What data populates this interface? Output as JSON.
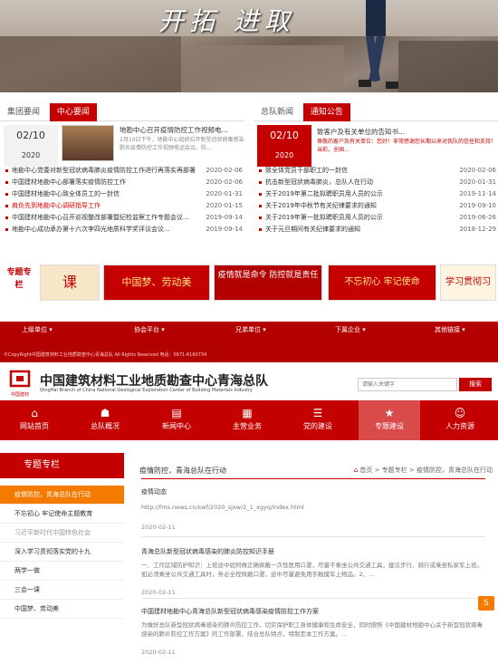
{
  "banner": {
    "slogan": "开拓 进取"
  },
  "left_news": {
    "tabs": [
      "集团要闻",
      "中心要闻"
    ],
    "feature": {
      "date": "02/10",
      "year": "2020",
      "title": "地勘中心召开疫情防控工作视频电...",
      "summary": "2月10日下午，地勘中心组织召开新型冠状病毒感染肺炎疫情防控工作视频电话会议。防..."
    },
    "items": [
      {
        "title": "地勘中心党委对新型冠状病毒肺炎疫情防控工作进行再落实再部署",
        "date": "2020-02-06",
        "highlight": false
      },
      {
        "title": "中国建材地勘中心部署落实疫情防控工作",
        "date": "2020-02-06",
        "highlight": false
      },
      {
        "title": "中国建材地勘中心致全体员工的一封信",
        "date": "2020-01-31",
        "highlight": false
      },
      {
        "title": "肩负先到地勘中心调研指导工作",
        "date": "2020-01-15",
        "highlight": true
      },
      {
        "title": "中国建材地勘中心召开巡视整改部署暨纪检监察工作专题会议...",
        "date": "2019-09-14",
        "highlight": false
      },
      {
        "title": "地勘中心成功承办第十六次李四光地质科学奖评议会议...",
        "date": "2019-09-14",
        "highlight": false
      }
    ]
  },
  "right_news": {
    "tabs": [
      "总队新闻",
      "通知公告"
    ],
    "feature": {
      "date": "02/10",
      "year": "2020",
      "title": "致客户及有关单位的告知书...",
      "summary": "尊敬的客户及有关单位：您好！非常感谢您长期以来对我队的信任和支持！当前，全国..."
    },
    "items": [
      {
        "title": "致全体党员干部职工的一封信",
        "date": "2020-02-06"
      },
      {
        "title": "抗击新型冠状病毒肺炎，总队人在行动",
        "date": "2020-01-31"
      },
      {
        "title": "关于2019年第二批拟聘职员用人员的公示",
        "date": "2019-11-14"
      },
      {
        "title": "关于2019年中秋节有关纪律要求的通知",
        "date": "2019-09-10"
      },
      {
        "title": "关于2019年第一批拟聘职员用人员的公示",
        "date": "2019-06-26"
      },
      {
        "title": "关于元旦期间有关纪律要求的通知",
        "date": "2018-12-29"
      }
    ]
  },
  "special": {
    "label": "专题专栏",
    "cards": [
      {
        "text": "课",
        "bg": "#f6e7c8",
        "color": "#c40000"
      },
      {
        "text": "中国梦、劳动美",
        "bg": "#c40000",
        "color": "#ffe680"
      },
      {
        "text": "疫情就是命令 防控就是责任",
        "bg": "#b30000",
        "color": "#fff"
      },
      {
        "text": "不忘初心 牢记使命",
        "bg": "#c40000",
        "color": "#ffe680"
      },
      {
        "text": "学习贯彻习",
        "bg": "#fff4e0",
        "color": "#c40000"
      }
    ]
  },
  "footer": {
    "selects": [
      "上级单位",
      "协会平台",
      "兄弟单位",
      "下属企业",
      "其他链接"
    ],
    "copyright": "©CopyRight中国建筑材料工业地质勘查中心青海总队 All Rights Reserved 电话：0971-6160734"
  },
  "header2": {
    "logo_text": "中国建材",
    "org_cn": "中国建筑材料工业地质勘查中心青海总队",
    "org_en": "QingHai Branch of China National Geological Exploration Center of Building Materials Industry",
    "search_placeholder": "请输入关键字",
    "search_button": "搜索"
  },
  "nav2": [
    {
      "label": "网站首页",
      "icon": "⌂"
    },
    {
      "label": "总队概况",
      "icon": "☗"
    },
    {
      "label": "新闻中心",
      "icon": "▤"
    },
    {
      "label": "主营业务",
      "icon": "▦"
    },
    {
      "label": "党的建设",
      "icon": "☰"
    },
    {
      "label": "专题建设",
      "icon": "★"
    },
    {
      "label": "人力资源",
      "icon": "☺"
    }
  ],
  "sidebar": {
    "title": "专题专栏",
    "items": [
      {
        "label": "疫情防控，青海总队在行动",
        "state": "active"
      },
      {
        "label": "不忘初心 牢记使命主题教育",
        "state": ""
      },
      {
        "label": "习近平新时代中国特色社会",
        "state": "dim"
      },
      {
        "label": "深入学习贯彻落实党的十九",
        "state": ""
      },
      {
        "label": "两学一做",
        "state": ""
      },
      {
        "label": "三会一课",
        "state": ""
      },
      {
        "label": "中国梦、劳动美",
        "state": ""
      }
    ]
  },
  "main": {
    "title": "疫情防控，青海总队在行动",
    "breadcrumb": "首页 > 专题专栏 > 疫情防控，青海总队在行动",
    "articles": [
      {
        "title": "疫情动态",
        "summary": "http://fms.news.cn/swf/2020_sjxw/2_1_xgyq/index.html",
        "date": "2020-02-11"
      },
      {
        "title": "青海总队新型冠状病毒感染的肺炎防控知识手册",
        "summary": "一、工作区域防护知识：上班途中如何做正确佩戴一次性医用口罩，尽量不乘坐公共交通工具，建议步行、骑行或乘坐私家车上班。如必须乘坐公共交通工具时，务必全程佩戴口罩，途中尽量避免用手触摸车上物品。2、...",
        "date": "2020-02-11"
      },
      {
        "title": "中国建材地勘中心青海总队新型冠状病毒感染疫情防控工作方案",
        "summary": "为做好总队新型冠状病毒感染的肺炎防控工作，切实保护职工身体健康和生命安全，同时按照《中国建材地勘中心关于新型冠状病毒感染的肺炎防控工作方案》的工作部署，结合总队特点，特制定本工作方案。...",
        "date": "2020-02-11"
      }
    ]
  }
}
